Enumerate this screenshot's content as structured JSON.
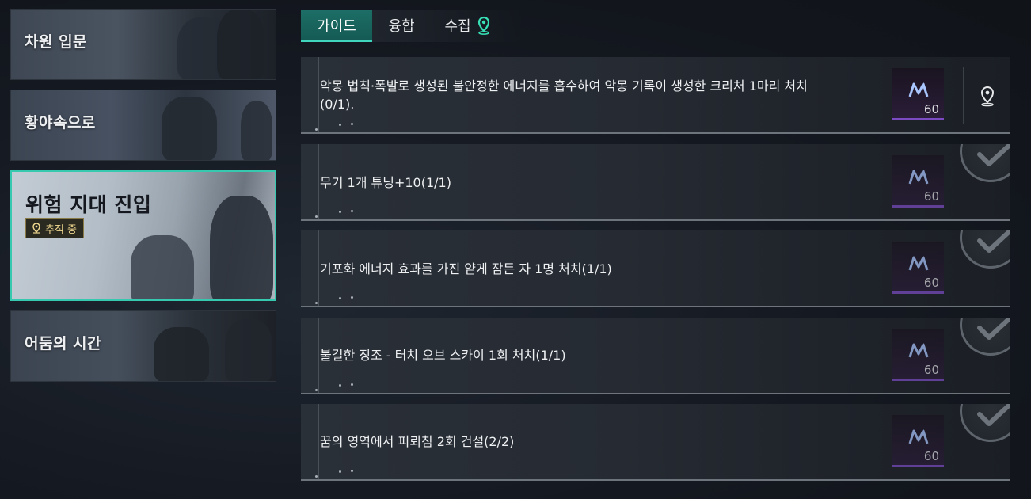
{
  "chapters": [
    {
      "title": "차원 입문"
    },
    {
      "title": "황야속으로"
    },
    {
      "title": "위험 지대 진입",
      "badge": "추적 중"
    },
    {
      "title": "어둠의 시간"
    }
  ],
  "tabs": [
    {
      "label": "가이드"
    },
    {
      "label": "융합"
    },
    {
      "label": "수집"
    }
  ],
  "quests": [
    {
      "desc": "악몽 법칙·폭발로 생성된 불안정한 에너지를 흡수하여 악몽 기록이 생성한 크리처 1마리 처치(0/1).",
      "reward": "60",
      "state": "active"
    },
    {
      "desc": "무기 1개 튜닝+10(1/1)",
      "reward": "60",
      "state": "done"
    },
    {
      "desc": "기포화 에너지 효과를 가진 얕게 잠든 자 1명 처치(1/1)",
      "reward": "60",
      "state": "done"
    },
    {
      "desc": "불길한 징조 - 터치 오브 스카이 1회 처치(1/1)",
      "reward": "60",
      "state": "done"
    },
    {
      "desc": "꿈의 영역에서 피뢰침 2회 건설(2/2)",
      "reward": "60",
      "state": "done"
    }
  ],
  "colors": {
    "accent": "#37c9b0",
    "reward_border": "#7a4bc2",
    "badge_text": "#f0d890"
  },
  "icons": {
    "tab_collect": "location-pin-icon",
    "track": "location-pin-icon",
    "reward": "currency-n-icon",
    "complete": "checkmark-icon"
  }
}
